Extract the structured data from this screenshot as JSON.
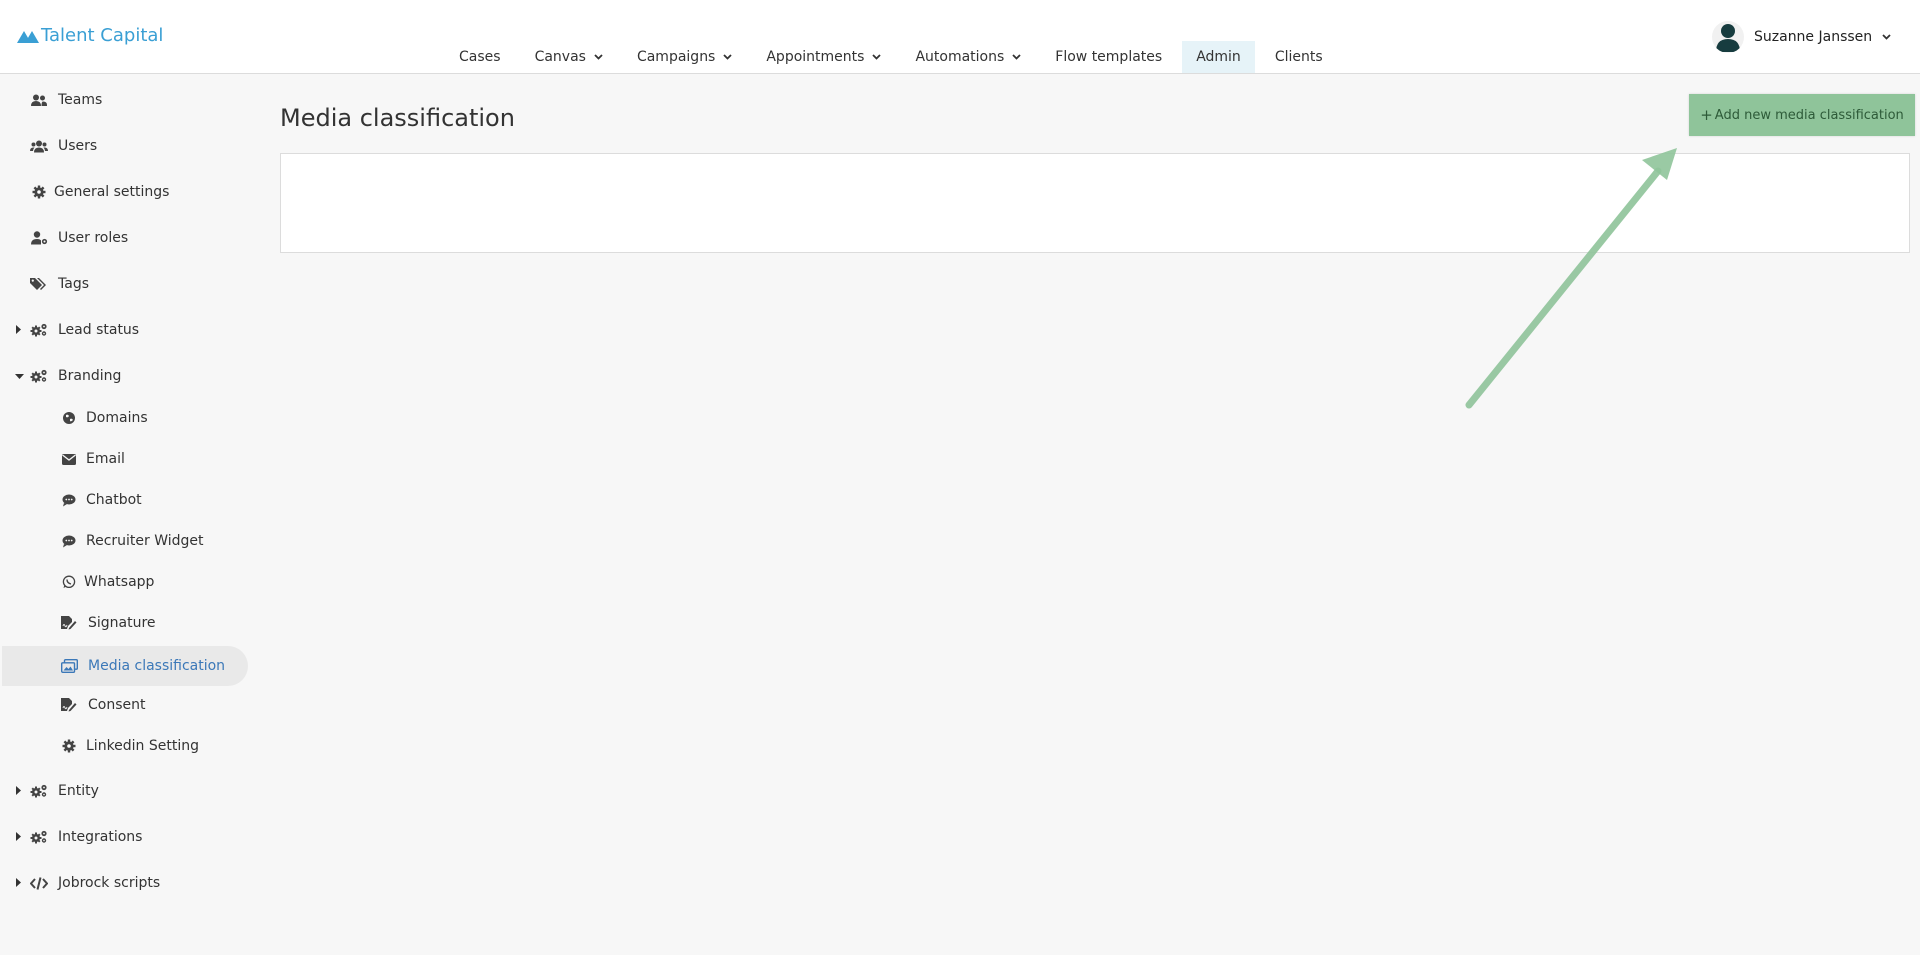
{
  "app": {
    "logo_text": "Talent Capital"
  },
  "nav": {
    "items": [
      {
        "label": "Cases"
      },
      {
        "label": "Canvas"
      },
      {
        "label": "Campaigns"
      },
      {
        "label": "Appointments"
      },
      {
        "label": "Automations"
      },
      {
        "label": "Flow templates"
      },
      {
        "label": "Admin"
      },
      {
        "label": "Clients"
      }
    ]
  },
  "user": {
    "name": "Suzanne Janssen"
  },
  "sidebar": {
    "items": [
      {
        "label": "Teams",
        "icon": "users-icon"
      },
      {
        "label": "Users",
        "icon": "user-group-icon"
      },
      {
        "label": "General settings",
        "icon": "gear-icon"
      },
      {
        "label": "User roles",
        "icon": "user-cog-icon"
      },
      {
        "label": "Tags",
        "icon": "tags-icon"
      },
      {
        "label": "Lead status",
        "icon": "gears-icon"
      },
      {
        "label": "Branding",
        "icon": "gears-icon"
      },
      {
        "label": "Domains",
        "icon": "globe-icon"
      },
      {
        "label": "Email",
        "icon": "envelope-icon"
      },
      {
        "label": "Chatbot",
        "icon": "chat-icon"
      },
      {
        "label": "Recruiter Widget",
        "icon": "chat-icon"
      },
      {
        "label": "Whatsapp",
        "icon": "whatsapp-icon"
      },
      {
        "label": "Signature",
        "icon": "signature-icon"
      },
      {
        "label": "Media classification",
        "icon": "images-icon"
      },
      {
        "label": "Consent",
        "icon": "signature-icon"
      },
      {
        "label": "Linkedin Setting",
        "icon": "gear-icon"
      },
      {
        "label": "Entity",
        "icon": "gears-icon"
      },
      {
        "label": "Integrations",
        "icon": "gears-icon"
      },
      {
        "label": "Jobrock scripts",
        "icon": "code-icon"
      }
    ]
  },
  "main": {
    "title": "Media classification",
    "add_button_label": "Add new media classification"
  },
  "colors": {
    "brand": "#3a9fd4",
    "active_link": "#3b78b8",
    "button_bg": "#8fc49a",
    "arrow": "#8fc49a"
  }
}
